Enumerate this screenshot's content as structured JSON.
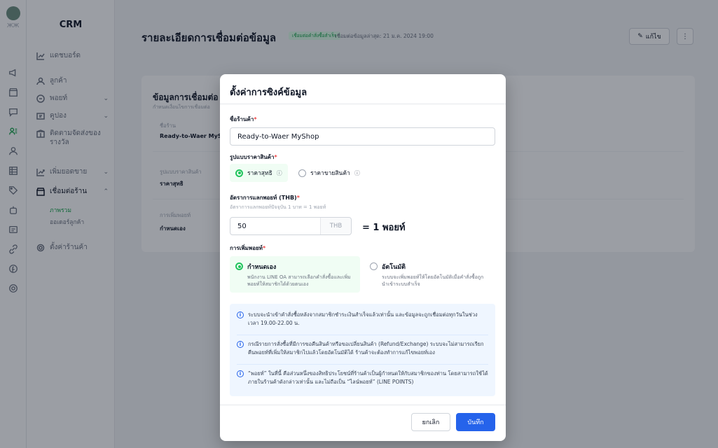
{
  "sidebar": {
    "brand": "CRM",
    "logo_sub": "ЖЖ",
    "items": [
      {
        "label": "แดชบอร์ด"
      },
      {
        "label": "ลูกค้า"
      },
      {
        "label": "พอยท์"
      },
      {
        "label": "คูปอง"
      },
      {
        "label": "ติดตามจัดส่งของรางวัล"
      },
      {
        "label": "เพิ่มยอดขาย"
      },
      {
        "label": "เชื่อมต่อร้าน"
      },
      {
        "label": "ตั้งค่าร้านค้า"
      }
    ],
    "sub_items": [
      {
        "label": "ภาพรวม"
      },
      {
        "label": "ออเดอร์ลูกค้า"
      }
    ]
  },
  "header": {
    "title": "รายละเอียดการเชื่อมต่อข้อมูล",
    "status_badge": "เชื่อมต่อคำสั่งซื้อสำเร็จ",
    "last_sync": "เชื่อมต่อข้อมูลล่าสุด: 21 ม.ค. 2024 19:00",
    "edit_label": "แก้ไข",
    "more_label": "⋮"
  },
  "card": {
    "title": "ข้อมูลการเชื่อมต่อ",
    "subtitle": "กำหนดเงื่อนไขการเชื่อมต่อ",
    "fields": [
      {
        "label": "ชื่อร้าน",
        "value": "Ready-to-Waer MyShop"
      },
      {
        "label": "รูปแบบราคาสินค้า",
        "value": "ราคาสุทธิ"
      },
      {
        "label": "การเพิ่มพอยท์",
        "value": "กำหนดเอง"
      }
    ]
  },
  "modal": {
    "title": "ตั้งค่าการซิงค์ข้อมูล",
    "store_name_label": "ชื่อร้านค้า",
    "store_name_value": "Ready-to-Waer MyShop",
    "price_type_label": "รูปแบบราคาสินค้า",
    "price_options": [
      {
        "label": "ราคาสุทธิ",
        "selected": true
      },
      {
        "label": "ราคาขายสินค้า",
        "selected": false
      }
    ],
    "rate_label": "อัตราการแลกพอยท์ (THB)",
    "rate_hint": "อัตราการแลกพอยท์ปัจจุบัน 1 บาท = 1 พอยท์",
    "rate_value": "50",
    "rate_unit": "THB",
    "rate_equals": "= 1 พอยท์",
    "mode_label": "การเพิ่มพอยท์",
    "mode_options": [
      {
        "title": "กำหนดเอง",
        "desc": "พนักงาน LINE OA สามารถเลือกคำสั่งซื้อและเพิ่มพอยท์ให้สมาชิกได้ด้วยตนเอง",
        "selected": true
      },
      {
        "title": "อัตโนมัติ",
        "desc": "ระบบจะเพิ่มพอยท์ให้โดยอัตโนมัติเมื่อคำสั่งซื้อถูกนำเข้าระบบสำเร็จ",
        "selected": false
      }
    ],
    "notices": [
      "ระบบจะนำเข้าคำสั่งซื้อหลังจากสมาชิกชำระเงินสำเร็จแล้วเท่านั้น และข้อมูลจะถูกเชื่อมต่อทุกวันในช่วงเวลา 19.00-22.00 น.",
      "กรณีรายการสั่งซื้อที่มีการขอคืนสินค้าหรือขอเปลี่ยนสินค้า (Refund/Exchange) ระบบจะไม่สามารถเรียกคืนพอยท์ที่เพิ่มให้สมาชิกไปแล้วโดยอัตโนมัติได้ ร้านค้าจะต้องทำการแก้ไขพอยท์เอง",
      "“พอยท์” ในที่นี้ คือส่วนหนึ่งของสิทธิประโยชน์ที่ร้านค้าเป็นผู้กำหนดให้กับสมาชิกของท่าน โดยสามารถใช้ได้ภายในร้านค้าดังกล่าวเท่านั้น และไม่ถือเป็น “ไลน์พอยท์” (LINE POINTS)"
    ],
    "cancel_label": "ยกเลิก",
    "save_label": "บันทึก"
  },
  "colors": {
    "accent": "#2563eb",
    "success": "#22c55e",
    "overlay": "rgba(17,24,39,0.42)"
  }
}
